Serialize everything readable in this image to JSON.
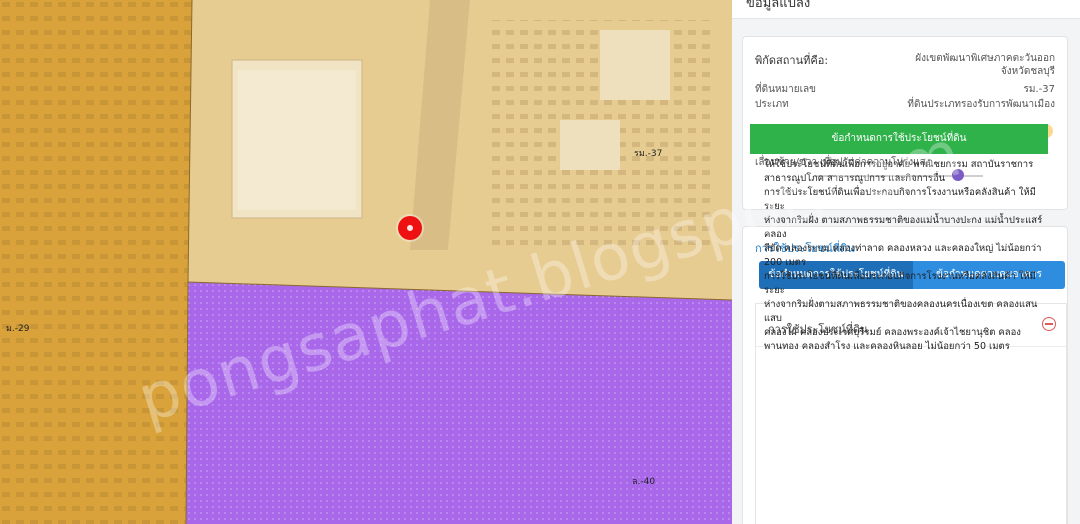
{
  "map": {
    "zone_labels": [
      "รม.-37",
      "ม.-29",
      "ล.-40"
    ],
    "colors": {
      "orange_zone": "#d9a23a",
      "beige_zone": "#e7cc92",
      "purple_zone": "#a968ea",
      "marker": "#ee1111"
    },
    "marker_icon": "location-dot-icon"
  },
  "watermark": "pongsaphat.blogspot.com",
  "panel": {
    "header": "ข้อมูลแปลง",
    "info": {
      "location_label": "พิกัดสถานที่คือ:",
      "location_value_1": "ผังเขตพัฒนาพิเศษภาคตะวันออก",
      "location_value_2": "จังหวัดชลบุรี",
      "zone_no_label": "ที่ดินหมายเลข",
      "zone_no_value": "รม.-37",
      "type_label": "ประเภท",
      "type_value": "ที่ดินประเภทรองรับการพัฒนาเมือง",
      "opacity_label": "เลื่อนซ้าย/ขวา เพื่อปรับค่าความโปร่งแสง",
      "opacity_value": 0.85
    },
    "landuse": {
      "title": "การใช้ประโยชน์ที่ดิน",
      "tabs": [
        "ข้อกำหนดการใช้ประโยชน์ที่ดิน",
        "ข้อกำหนดควบคุมอาคาร"
      ],
      "accordion_title": "การใช้ประโยชน์ที่ดิน",
      "table_head": "ข้อกำหนดการใช้ประโยชน์ที่ดิน",
      "lines": [
        "ให้ใช้ประโยชน์ที่ดินเพื่อการอยู่อาศัย พาณิชยกรรม สถาบันราชการ",
        "สาธารณูปโภค สาธารณูปการ และกิจการอื่น",
        "การใช้ประโยชน์ที่ดินเพื่อประกอบกิจการโรงงานหรือคลังสินค้า ให้มีระยะ",
        "ห่างจากริมฝั่ง ตามสภาพธรรมชาติของแม่น้ำบางปะกง แม่น้ำประแสร์ คลอง",
        "สียัด คลองระบม คลองท่าลาด คลองหลวง และคลองใหญ่ ไม่น้อยกว่า",
        "200 เมตร",
        "การใช้ประโยชน์ที่ดินเพื่อประกอบกิจการโรงงานหรือคลังสินค้า ให้มีระยะ",
        "ห่างจากริมฝั่งตามสภาพธรรมชาติของคลองนครเนื่องเขต คลองแสนแสบ",
        "คลองไผ่ คลองประเวศบุรีรมย์ คลองพระองค์เจ้าไชยานุชิต คลอง",
        "พานทอง คลองสำโรง และคลองหินลอย ไม่น้อยกว่า 50 เมตร"
      ]
    }
  }
}
